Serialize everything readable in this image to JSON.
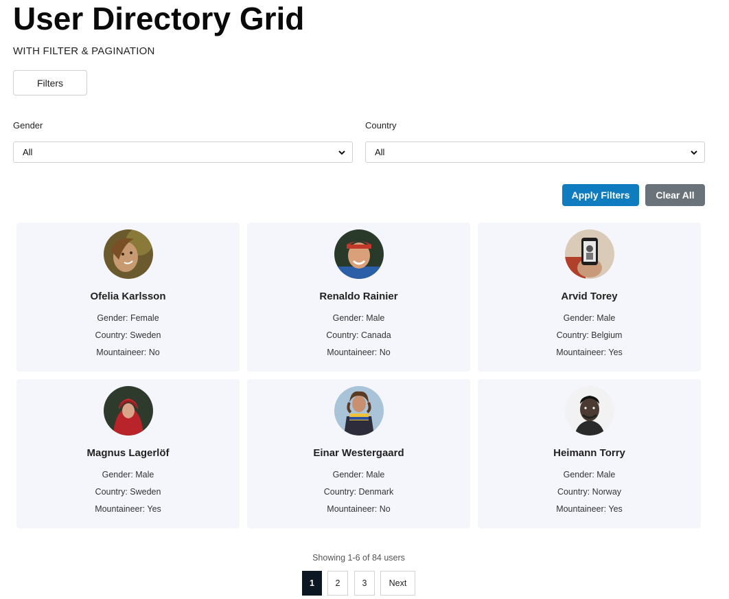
{
  "header": {
    "title": "User Directory Grid",
    "subtitle": "WITH FILTER & PAGINATION"
  },
  "filters": {
    "toggle_label": "Filters",
    "gender_label": "Gender",
    "gender_value": "All",
    "country_label": "Country",
    "country_value": "All",
    "apply_label": "Apply Filters",
    "clear_label": "Clear All"
  },
  "users": [
    {
      "name": "Ofelia Karlsson",
      "gender": "Gender: Female",
      "country": "Country: Sweden",
      "mountaineer": "Mountaineer: No"
    },
    {
      "name": "Renaldo Rainier",
      "gender": "Gender: Male",
      "country": "Country: Canada",
      "mountaineer": "Mountaineer: No"
    },
    {
      "name": "Arvid Torey",
      "gender": "Gender: Male",
      "country": "Country: Belgium",
      "mountaineer": "Mountaineer: Yes"
    },
    {
      "name": "Magnus Lagerlöf",
      "gender": "Gender: Male",
      "country": "Country: Sweden",
      "mountaineer": "Mountaineer: Yes"
    },
    {
      "name": "Einar Westergaard",
      "gender": "Gender: Male",
      "country": "Country: Denmark",
      "mountaineer": "Mountaineer: No"
    },
    {
      "name": "Heimann Torry",
      "gender": "Gender: Male",
      "country": "Country: Norway",
      "mountaineer": "Mountaineer: Yes"
    }
  ],
  "pagination": {
    "showing": "Showing 1-6 of 84 users",
    "pages": [
      "1",
      "2",
      "3"
    ],
    "current": "1",
    "next_label": "Next"
  },
  "colors": {
    "apply": "#0e7cbf",
    "clear": "#6b737a",
    "card_bg": "#f5f6fc",
    "active_page": "#0b1723"
  }
}
